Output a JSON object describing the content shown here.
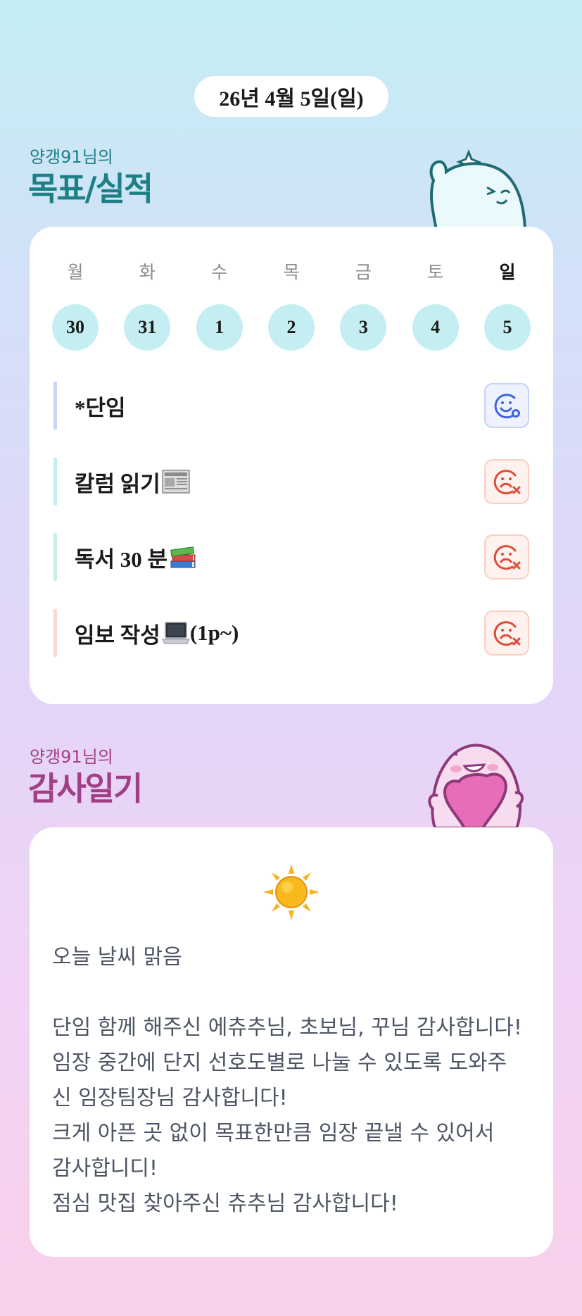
{
  "header": {
    "date": "26년 4월 5일(일)"
  },
  "goals_section": {
    "subtitle": "양갱91님의",
    "title": "목표/실적"
  },
  "week": [
    {
      "day": "월",
      "num": "30",
      "active": false
    },
    {
      "day": "화",
      "num": "31",
      "active": false
    },
    {
      "day": "수",
      "num": "1",
      "active": false
    },
    {
      "day": "목",
      "num": "2",
      "active": false
    },
    {
      "day": "금",
      "num": "3",
      "active": false
    },
    {
      "day": "토",
      "num": "4",
      "active": false
    },
    {
      "day": "일",
      "num": "5",
      "active": true
    }
  ],
  "goals": [
    {
      "text": "*단임",
      "emoji_icon": "",
      "suffix": "",
      "status": "done",
      "bar_color": "#c9d4f8"
    },
    {
      "text": "칼럼 읽기",
      "emoji_icon": "newspaper-icon",
      "suffix": "",
      "status": "fail",
      "bar_color": "#c2eef4"
    },
    {
      "text": "독서 30 분",
      "emoji_icon": "books-icon",
      "suffix": "",
      "status": "fail",
      "bar_color": "#c4eedd"
    },
    {
      "text": "임보 작성",
      "emoji_icon": "laptop-icon",
      "suffix": " (1p~)",
      "status": "fail",
      "bar_color": "#fbd6d6"
    }
  ],
  "diary_section": {
    "subtitle": "양갱91님의",
    "title": "감사일기",
    "weather_icon": "sun-icon",
    "body": "오늘 날씨 맑음\n\n단임 함께 해주신 에츄추님, 초보님, 꾸님 감사합니다!\n임장 중간에 단지 선호도별로 나눌 수 있도록 도와주\n신 임장팀장님 감사합니다!\n크게 아픈 곳 없이 목표한만큼 임장 끝낼 수 있어서\n감사합니디!\n점심 맛집 찾아주신 츄추님 감사합니다!"
  },
  "colors": {
    "goals_accent": "#1e7f86",
    "diary_accent": "#a13f86",
    "status_done": "#3d64e0",
    "status_fail": "#e04a38"
  }
}
